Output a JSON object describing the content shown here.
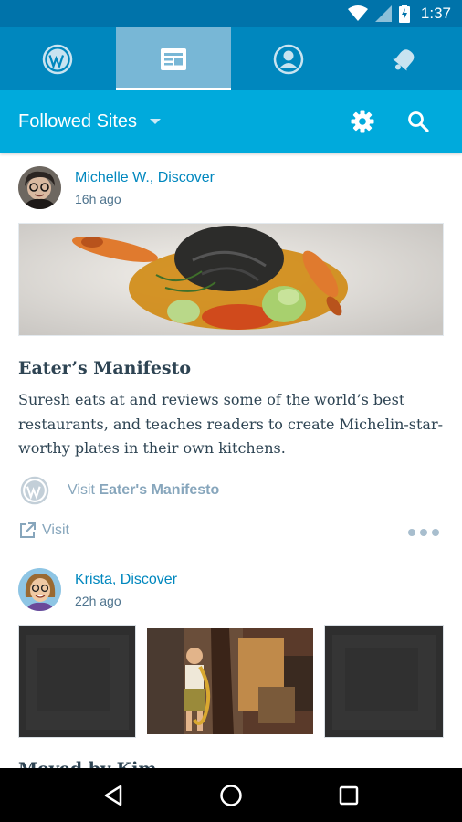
{
  "status_bar": {
    "time": "1:37"
  },
  "tabs": [
    {
      "name": "wordpress-tab",
      "icon": "wordpress-icon"
    },
    {
      "name": "reader-tab",
      "icon": "reader-icon",
      "active": true
    },
    {
      "name": "me-tab",
      "icon": "profile-icon"
    },
    {
      "name": "notifications-tab",
      "icon": "bell-icon"
    }
  ],
  "toolbar": {
    "title": "Followed Sites",
    "settings_icon": "gear-icon",
    "search_icon": "search-icon"
  },
  "posts": [
    {
      "author": "Michelle W., Discover",
      "time": "16h ago",
      "title": "Eater’s Manifesto",
      "excerpt": "Suresh eats at and reviews some of the world’s best restaurants, and teaches readers to create Michelin-star-worthy plates in their own kitchens.",
      "visit_prefix": "Visit",
      "visit_site": "Eater's Manifesto",
      "visit_action": "Visit"
    },
    {
      "author": "Krista, Discover",
      "time": "22h ago",
      "title": "Moved by Kim"
    }
  ],
  "colors": {
    "primary": "#0087be",
    "toolbar": "#00aadc",
    "statusbar": "#0073aa",
    "text": "#2e4453",
    "muted": "#87a6bc"
  }
}
